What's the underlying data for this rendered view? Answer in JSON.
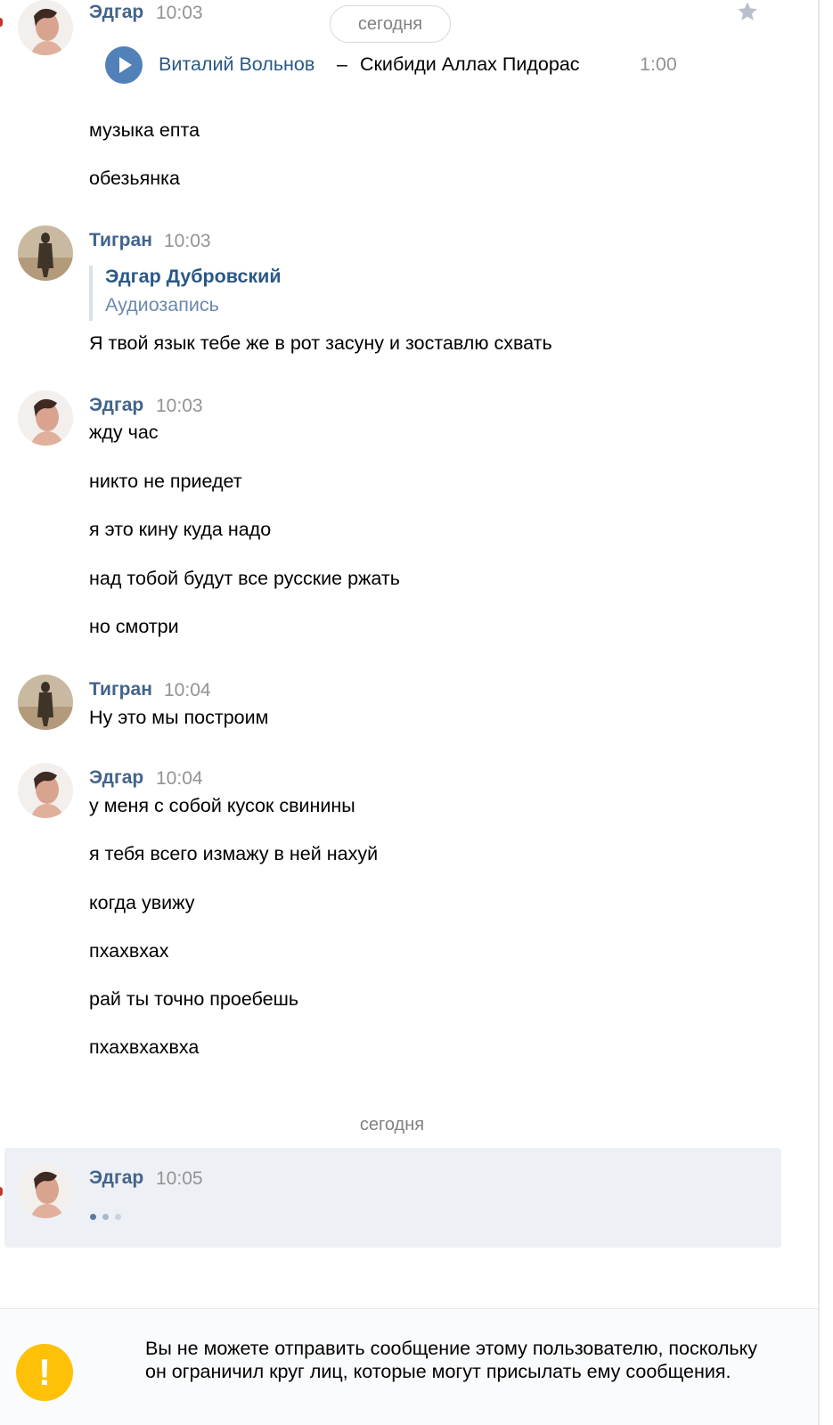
{
  "date_pill": "сегодня",
  "divider_date": "сегодня",
  "colors": {
    "accent": "#5181b8",
    "author": "#42648b",
    "highlight": "#edf0f5",
    "warning": "#ffc107"
  },
  "messages": [
    {
      "author": "Эдгар",
      "time": "10:03",
      "audio": {
        "artist": "Виталий Вольнов",
        "dash": "–",
        "title": "Скибиди Аллах Пидорас",
        "duration": "1:00"
      },
      "lines": [
        "музыка епта",
        "обезьянка"
      ]
    },
    {
      "author": "Тигран",
      "time": "10:03",
      "reply": {
        "author": "Эдгар Дубровский",
        "type": "Аудиозапись"
      },
      "lines": [
        "Я твой язык тебе же в рот засуну и зоставлю схвать"
      ]
    },
    {
      "author": "Эдгар",
      "time": "10:03",
      "lines": [
        "жду час",
        "никто не приедет",
        "я это кину куда надо",
        "над тобой будут все русские ржать",
        "но смотри"
      ]
    },
    {
      "author": "Тигран",
      "time": "10:04",
      "lines": [
        "Ну это мы построим"
      ]
    },
    {
      "author": "Эдгар",
      "time": "10:04",
      "lines": [
        "у меня с собой кусок свинины",
        "я тебя всего измажу в ней нахуй",
        "когда увижу",
        "пхахвхах",
        "рай ты точно проебешь",
        "пхахвхахвха"
      ]
    },
    {
      "author": "Эдгар",
      "time": "10:05",
      "typing": true
    }
  ],
  "notice": {
    "icon": "warning-icon",
    "text": "Вы не можете отправить сообщение этому пользователю, поскольку он ограничил круг лиц, которые могут присылать ему сообщения."
  }
}
